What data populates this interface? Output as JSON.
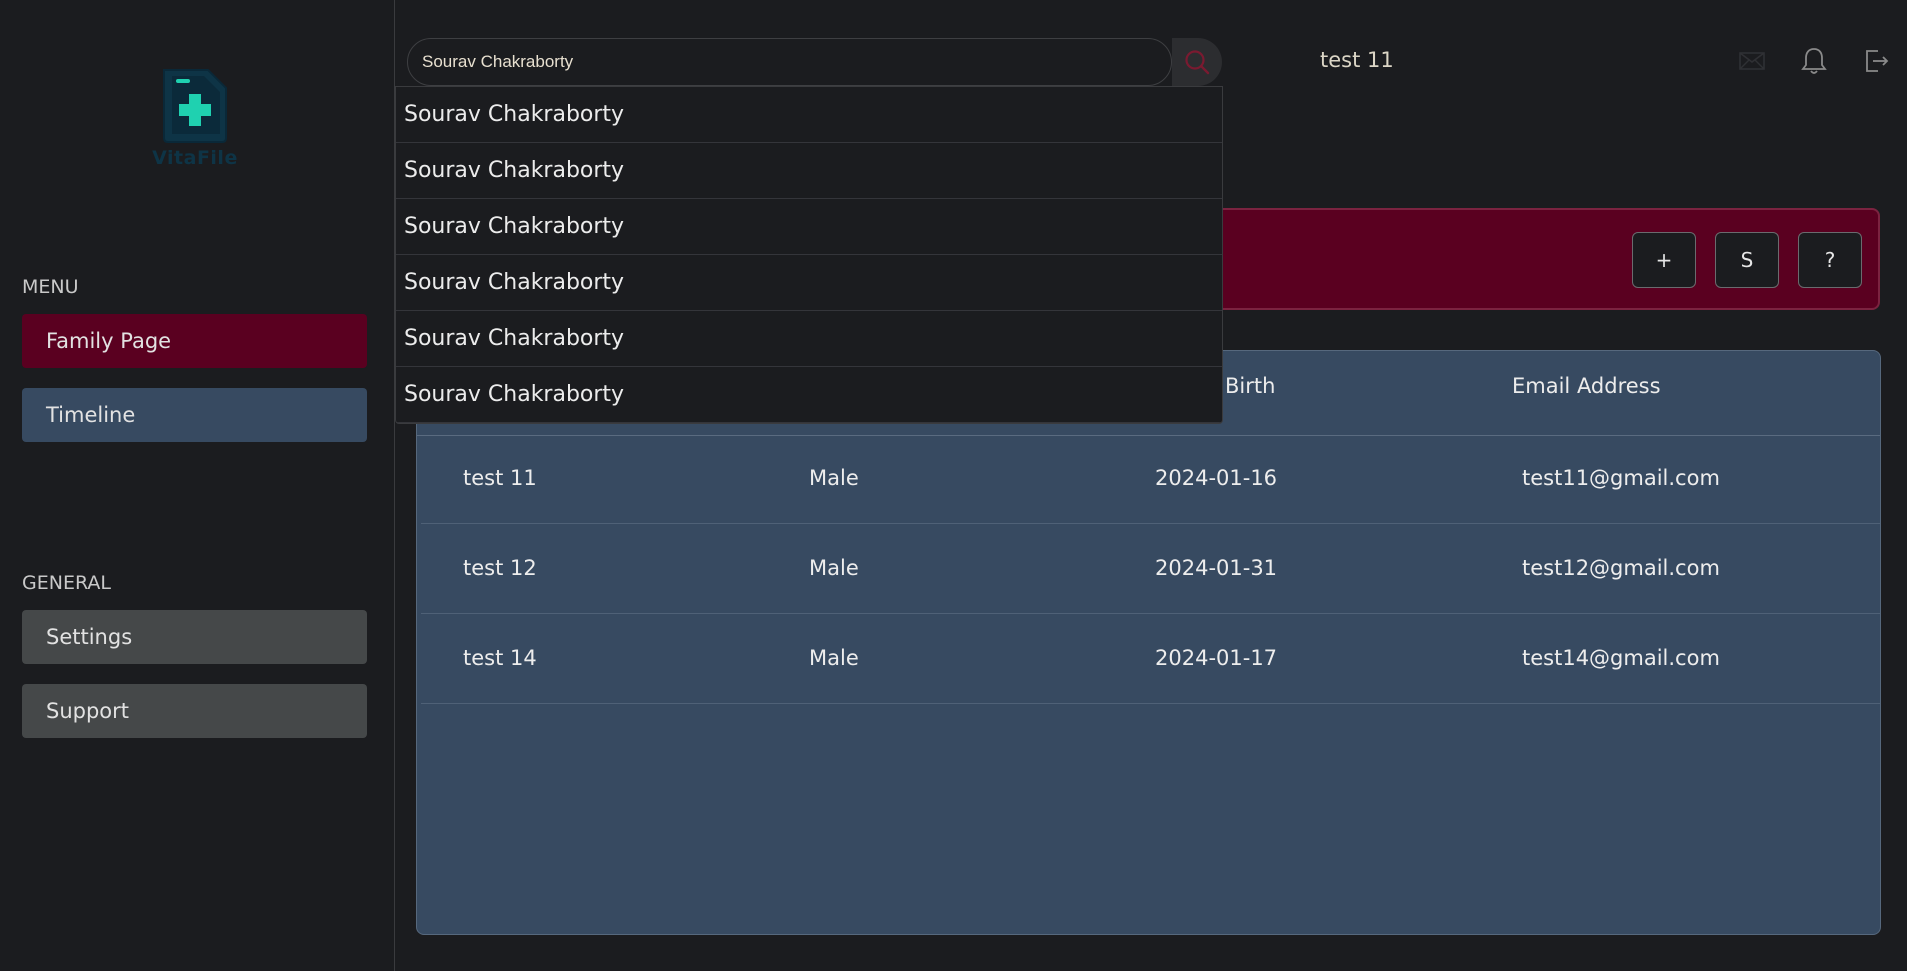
{
  "app": {
    "logo_text": "VitaFile"
  },
  "sidebar": {
    "menu_title": "MENU",
    "menu_items": [
      {
        "label": "Family Page"
      },
      {
        "label": "Timeline"
      }
    ],
    "general_title": "GENERAL",
    "general_items": [
      {
        "label": "Settings"
      },
      {
        "label": "Support"
      }
    ]
  },
  "search": {
    "value": "Sourav Chakraborty",
    "suggestions": [
      "Sourav Chakraborty",
      "Sourav Chakraborty",
      "Sourav Chakraborty",
      "Sourav Chakraborty",
      "Sourav Chakraborty",
      "Sourav Chakraborty"
    ]
  },
  "header": {
    "user_name": "test 11",
    "icons": [
      "mail-icon",
      "bell-icon",
      "logout-icon"
    ]
  },
  "actions": {
    "add_label": "+",
    "s_label": "S",
    "help_label": "?"
  },
  "table": {
    "columns": [
      "",
      "",
      "Birth",
      "Email Address"
    ],
    "rows": [
      {
        "name": "test 11",
        "gender": "Male",
        "dob": "2024-01-16",
        "email": "test11@gmail.com"
      },
      {
        "name": "test 12",
        "gender": "Male",
        "dob": "2024-01-31",
        "email": "test12@gmail.com"
      },
      {
        "name": "test 14",
        "gender": "Male",
        "dob": "2024-01-17",
        "email": "test14@gmail.com"
      }
    ]
  },
  "colors": {
    "background": "#1b1c1f",
    "crimson": "#5a0020",
    "panel_blue": "#374a61",
    "gray_button": "#454849",
    "logo_teal": "#1fd1b0"
  }
}
